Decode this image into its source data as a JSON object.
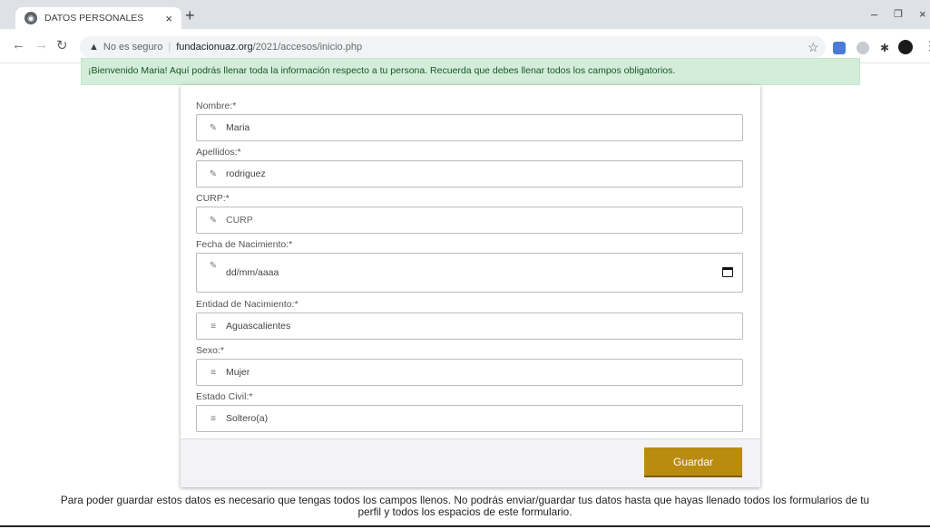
{
  "tab": {
    "title": "DATOS PERSONALES",
    "close": "×",
    "new_tab": "+"
  },
  "window": {
    "minimize": "–",
    "restore": "❐",
    "close": "×"
  },
  "address": {
    "security_label": "No es seguro",
    "host": "fundacionuaz.org",
    "path": "/2021/accesos/inicio.php"
  },
  "alert": {
    "text": "¡Bienvenido Maria! Aquí podrás llenar toda la información respecto a tu persona. Recuerda que debes llenar todos los campos obligatorios."
  },
  "form": {
    "nombre": {
      "label": "Nombre:*",
      "value": "Maria"
    },
    "apellidos": {
      "label": "Apellidos:*",
      "value": "rodriguez"
    },
    "curp": {
      "label": "CURP:*",
      "placeholder": "CURP"
    },
    "fecha": {
      "label": "Fecha de Nacimiento:*",
      "placeholder": "dd/mm/aaaa"
    },
    "entidad": {
      "label": "Entidad de Nacimiento:*",
      "value": "Aguascalientes"
    },
    "sexo": {
      "label": "Sexo:*",
      "value": "Mujer"
    },
    "estado_civil": {
      "label": "Estado Civil:*",
      "value": "Soltero(a)"
    },
    "save_label": "Guardar"
  },
  "note": {
    "text": "Para poder guardar estos datos es necesario que tengas todos los campos llenos. No podrás enviar/guardar tus datos hasta que hayas llenado todos los formularios de tu perfil y todos los espacios de este formulario."
  },
  "icons": {
    "edit": "pencil-icon",
    "select": "list-icon",
    "date": "calendar-icon"
  },
  "colors": {
    "alert_bg": "#d4edda",
    "alert_text": "#155724",
    "accent": "#b98b0f"
  }
}
